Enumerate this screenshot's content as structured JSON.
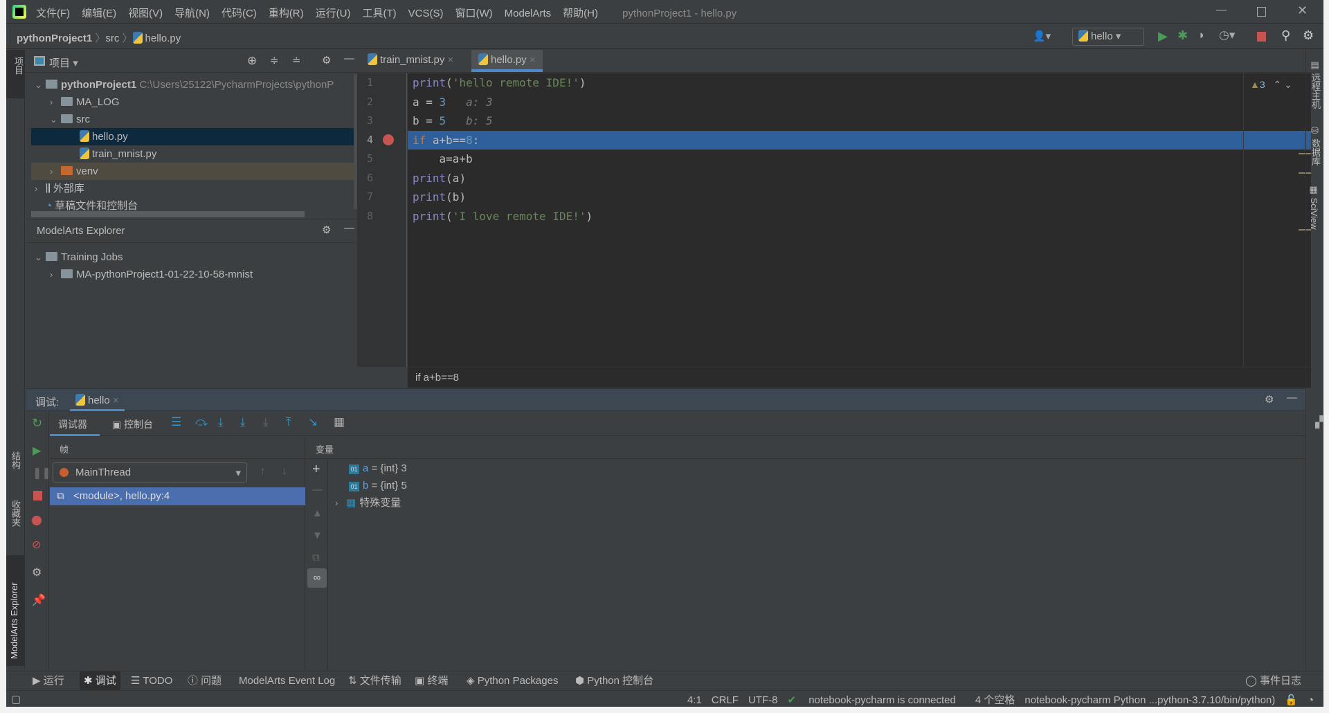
{
  "titlebar": {
    "menus": [
      "文件(F)",
      "编辑(E)",
      "视图(V)",
      "导航(N)",
      "代码(C)",
      "重构(R)",
      "运行(U)",
      "工具(T)",
      "VCS(S)",
      "窗口(W)",
      "ModelArts",
      "帮助(H)"
    ],
    "title": "pythonProject1 - hello.py"
  },
  "breadcrumb": [
    "pythonProject1",
    "src",
    "hello.py"
  ],
  "run_config": "hello",
  "project": {
    "header": "项目",
    "tree": [
      {
        "label": "pythonProject1",
        "path": "C:\\Users\\25122\\PycharmProjects\\pythonP"
      },
      {
        "label": "MA_LOG"
      },
      {
        "label": "src"
      },
      {
        "label": "hello.py"
      },
      {
        "label": "train_mnist.py"
      },
      {
        "label": "venv"
      },
      {
        "label": "外部库"
      },
      {
        "label": "草稿文件和控制台"
      }
    ]
  },
  "modelarts": {
    "header": "ModelArts Explorer",
    "items": [
      "Training Jobs",
      "MA-pythonProject1-01-22-10-58-mnist"
    ]
  },
  "editor": {
    "tabs": [
      "train_mnist.py",
      "hello.py"
    ],
    "active_tab": 1,
    "warnings": "3",
    "line_numbers": [
      "1",
      "2",
      "3",
      "4",
      "5",
      "6",
      "7",
      "8"
    ],
    "hints": {
      "a": "a: 3",
      "b": "b: 5"
    },
    "breadcrumb": "if a+b==8"
  },
  "right_stripe": [
    "远程主机",
    "数据库",
    "SciView"
  ],
  "left_stripe": [
    "项目",
    "结构",
    "收藏夹",
    "ModelArts Explorer"
  ],
  "debug": {
    "label": "调试:",
    "session": "hello",
    "tabs": [
      "调试器",
      "控制台"
    ],
    "frames_header": "帧",
    "vars_header": "变量",
    "thread": "MainThread",
    "frame": "<module>, hello.py:4",
    "variables": [
      {
        "name": "a",
        "value": "{int} 3"
      },
      {
        "name": "b",
        "value": "{int} 5"
      },
      {
        "name": "特殊变量",
        "value": ""
      }
    ]
  },
  "bottom_tabs": [
    "运行",
    "调试",
    "TODO",
    "问题",
    "ModelArts Event Log",
    "文件传输",
    "终端",
    "Python Packages",
    "Python 控制台"
  ],
  "event_log": "事件日志",
  "status": {
    "position": "4:1",
    "line_sep": "CRLF",
    "encoding": "UTF-8",
    "connection": "notebook-pycharm is connected",
    "indent": "4 个空格",
    "interpreter": "notebook-pycharm Python ...python-3.7.10/bin/python)"
  },
  "colors": {
    "accent": "#4a88c7",
    "selection_line": "#2f5f9a",
    "breakpoint": "#c75450",
    "run_green": "#499c54"
  }
}
